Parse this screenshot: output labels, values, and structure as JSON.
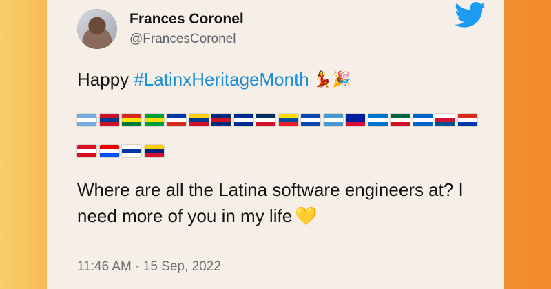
{
  "author": {
    "name": "Frances Coronel",
    "handle": "@FrancesCoronel"
  },
  "tweet": {
    "prefix": "Happy ",
    "hashtag": "#LatinxHeritageMonth",
    "emoji_after_hashtag": "💃🎉",
    "flags_row1": [
      {
        "country": "Argentina",
        "colors": [
          "#74acdf",
          "#ffffff",
          "#74acdf"
        ]
      },
      {
        "country": "Belize",
        "colors": [
          "#ce1126",
          "#003f87",
          "#ce1126"
        ]
      },
      {
        "country": "Bolivia",
        "colors": [
          "#d52b1e",
          "#f9e300",
          "#007934"
        ]
      },
      {
        "country": "Brazil",
        "colors": [
          "#009c3b",
          "#ffdf00",
          "#009c3b"
        ]
      },
      {
        "country": "Chile",
        "colors": [
          "#0039a6",
          "#ffffff",
          "#d52b1e"
        ]
      },
      {
        "country": "Colombia",
        "colors": [
          "#fcd116",
          "#003893",
          "#ce1126"
        ]
      },
      {
        "country": "Costa Rica",
        "colors": [
          "#002b7f",
          "#ce1126",
          "#002b7f"
        ]
      },
      {
        "country": "Cuba",
        "colors": [
          "#002a8f",
          "#ffffff",
          "#002a8f"
        ]
      },
      {
        "country": "Dominican Republic",
        "colors": [
          "#002d62",
          "#ffffff",
          "#ce1126"
        ]
      },
      {
        "country": "Ecuador",
        "colors": [
          "#ffdd00",
          "#034ea2",
          "#ed1c24"
        ]
      },
      {
        "country": "El Salvador",
        "colors": [
          "#0f47af",
          "#ffffff",
          "#0f47af"
        ]
      },
      {
        "country": "Guatemala",
        "colors": [
          "#4997d0",
          "#ffffff",
          "#4997d0"
        ]
      },
      {
        "country": "Haiti",
        "colors": [
          "#00209f",
          "#00209f",
          "#d21034"
        ]
      },
      {
        "country": "Honduras",
        "colors": [
          "#0073cf",
          "#ffffff",
          "#0073cf"
        ]
      },
      {
        "country": "Mexico",
        "colors": [
          "#006847",
          "#ffffff",
          "#ce1126"
        ]
      },
      {
        "country": "Nicaragua",
        "colors": [
          "#0067c6",
          "#ffffff",
          "#0067c6"
        ]
      },
      {
        "country": "Panama",
        "colors": [
          "#ffffff",
          "#d21034",
          "#005293"
        ]
      },
      {
        "country": "Paraguay",
        "colors": [
          "#d52b1e",
          "#ffffff",
          "#0038a8"
        ]
      }
    ],
    "flags_row2": [
      {
        "country": "Peru",
        "colors": [
          "#d91023",
          "#ffffff",
          "#d91023"
        ]
      },
      {
        "country": "Puerto Rico",
        "colors": [
          "#ed0000",
          "#ffffff",
          "#0050f0"
        ]
      },
      {
        "country": "Uruguay",
        "colors": [
          "#ffffff",
          "#0038a8",
          "#ffffff"
        ]
      },
      {
        "country": "Venezuela",
        "colors": [
          "#ffcc00",
          "#00247d",
          "#cf142b"
        ]
      }
    ],
    "body": "Where are all the Latina software engineers at? I need more of you in my life",
    "heart": "💛"
  },
  "timestamp": "11:46 AM · 15 Sep, 2022",
  "colors": {
    "hashtag": "#1d8fd6",
    "twitter_blue": "#1d9bf0",
    "card_bg": "#f6efe8"
  }
}
